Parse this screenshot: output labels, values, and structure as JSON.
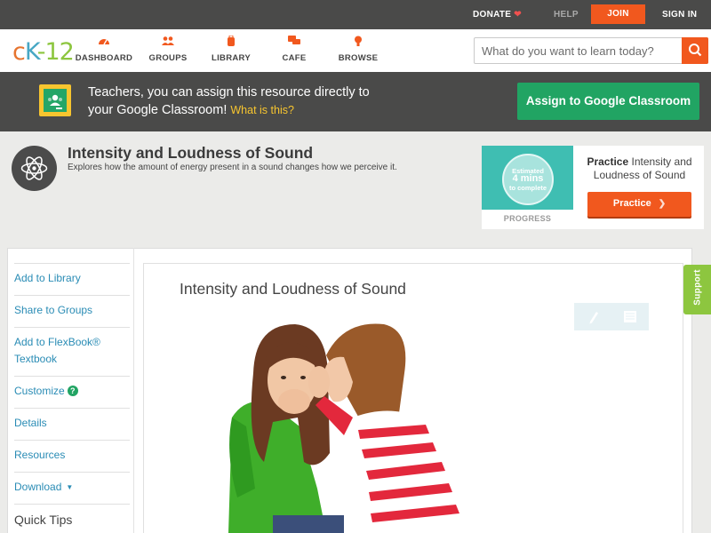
{
  "topbar": {
    "donate_label": "DONATE",
    "help_label": "HELP",
    "join_label": "JOIN",
    "signin_label": "SIGN IN"
  },
  "nav": {
    "logo_text": "cK-12",
    "items": [
      {
        "label": "DASHBOARD",
        "icon": "speedometer-icon"
      },
      {
        "label": "GROUPS",
        "icon": "people-icon"
      },
      {
        "label": "LIBRARY",
        "icon": "backpack-icon"
      },
      {
        "label": "CAFE",
        "icon": "chat-bubbles-icon"
      },
      {
        "label": "BROWSE",
        "icon": "lightbulb-icon"
      }
    ],
    "search_placeholder": "What do you want to learn today?"
  },
  "classroom_banner": {
    "line1": "Teachers, you can assign this resource directly to",
    "line2": "your Google Classroom!",
    "what_link": "What is this?",
    "assign_label": "Assign to Google Classroom"
  },
  "header": {
    "title": "Intensity and Loudness of Sound",
    "subtitle": "Explores how the amount of energy present in a sound changes how we perceive it."
  },
  "practice_card": {
    "estimated_line1": "Estimated",
    "estimated_line2": "4 mins",
    "estimated_line3": "to complete",
    "progress_label": "PROGRESS",
    "title_bold": "Practice",
    "title_rest": " Intensity and Loudness of Sound",
    "button_label": "Practice"
  },
  "sidebar": {
    "add_to_library": "Add to Library",
    "share_to_groups": "Share to Groups",
    "add_to_flexbook_1": "Add to FlexBook®",
    "add_to_flexbook_2": "Textbook",
    "customize": "Customize",
    "details": "Details",
    "resources": "Resources",
    "download": "Download",
    "quick_tips": "Quick Tips"
  },
  "content": {
    "title": "Intensity and Loudness of Sound"
  },
  "support_label": "Support",
  "colors": {
    "brand_orange": "#f1581e",
    "classroom_green": "#21a463",
    "link_blue": "#2a8cb5",
    "support_green": "#8dc63f"
  }
}
